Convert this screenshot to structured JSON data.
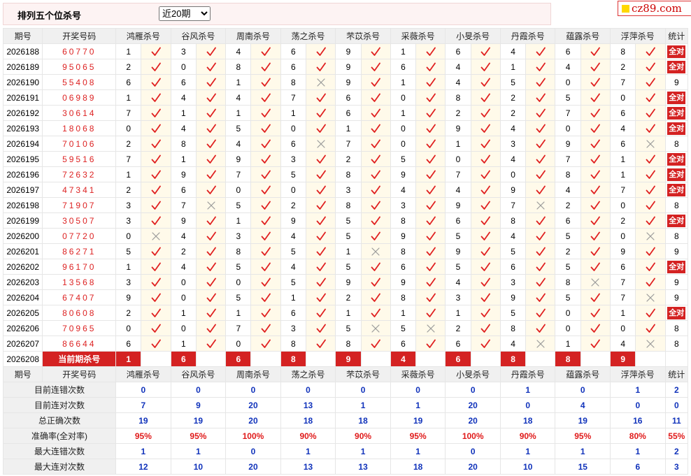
{
  "header": {
    "title": "排列五个位杀号",
    "period_select": "近20期",
    "logo": "cz89.com"
  },
  "columns": {
    "issue": "期号",
    "draw": "开奖号码",
    "stat": "统计",
    "experts": [
      "鸿雁杀号",
      "谷风杀号",
      "周南杀号",
      "荡之杀号",
      "芣苡杀号",
      "采薇杀号",
      "小旻杀号",
      "丹霞杀号",
      "蕴露杀号",
      "浮萍杀号"
    ]
  },
  "rows": [
    {
      "issue": "2026188",
      "draw": "60770",
      "k": [
        "1",
        "3",
        "4",
        "6",
        "9",
        "1",
        "6",
        "4",
        "6",
        "8"
      ],
      "r": [
        1,
        1,
        1,
        1,
        1,
        1,
        1,
        1,
        1,
        1
      ],
      "stat": "全对"
    },
    {
      "issue": "2026189",
      "draw": "95065",
      "k": [
        "2",
        "0",
        "8",
        "6",
        "9",
        "6",
        "4",
        "1",
        "4",
        "2"
      ],
      "r": [
        1,
        1,
        1,
        1,
        1,
        1,
        1,
        1,
        1,
        1
      ],
      "stat": "全对"
    },
    {
      "issue": "2026190",
      "draw": "55408",
      "k": [
        "6",
        "6",
        "1",
        "8",
        "9",
        "1",
        "4",
        "5",
        "0",
        "7"
      ],
      "r": [
        1,
        1,
        1,
        0,
        1,
        1,
        1,
        1,
        1,
        1
      ],
      "stat": "9"
    },
    {
      "issue": "2026191",
      "draw": "06989",
      "k": [
        "1",
        "4",
        "4",
        "7",
        "6",
        "0",
        "8",
        "2",
        "5",
        "0"
      ],
      "r": [
        1,
        1,
        1,
        1,
        1,
        1,
        1,
        1,
        1,
        1
      ],
      "stat": "全对"
    },
    {
      "issue": "2026192",
      "draw": "30614",
      "k": [
        "7",
        "1",
        "1",
        "1",
        "6",
        "1",
        "2",
        "2",
        "7",
        "6"
      ],
      "r": [
        1,
        1,
        1,
        1,
        1,
        1,
        1,
        1,
        1,
        1
      ],
      "stat": "全对"
    },
    {
      "issue": "2026193",
      "draw": "18068",
      "k": [
        "0",
        "4",
        "5",
        "0",
        "1",
        "0",
        "9",
        "4",
        "0",
        "4"
      ],
      "r": [
        1,
        1,
        1,
        1,
        1,
        1,
        1,
        1,
        1,
        1
      ],
      "stat": "全对"
    },
    {
      "issue": "2026194",
      "draw": "70106",
      "k": [
        "2",
        "8",
        "4",
        "6",
        "7",
        "0",
        "1",
        "3",
        "9",
        "6"
      ],
      "r": [
        1,
        1,
        1,
        0,
        1,
        1,
        1,
        1,
        1,
        0
      ],
      "stat": "8"
    },
    {
      "issue": "2026195",
      "draw": "59516",
      "k": [
        "7",
        "1",
        "9",
        "3",
        "2",
        "5",
        "0",
        "4",
        "7",
        "1"
      ],
      "r": [
        1,
        1,
        1,
        1,
        1,
        1,
        1,
        1,
        1,
        1
      ],
      "stat": "全对"
    },
    {
      "issue": "2026196",
      "draw": "72632",
      "k": [
        "1",
        "9",
        "7",
        "5",
        "8",
        "9",
        "7",
        "0",
        "8",
        "1"
      ],
      "r": [
        1,
        1,
        1,
        1,
        1,
        1,
        1,
        1,
        1,
        1
      ],
      "stat": "全对"
    },
    {
      "issue": "2026197",
      "draw": "47341",
      "k": [
        "2",
        "6",
        "0",
        "0",
        "3",
        "4",
        "4",
        "9",
        "4",
        "7"
      ],
      "r": [
        1,
        1,
        1,
        1,
        1,
        1,
        1,
        1,
        1,
        1
      ],
      "stat": "全对"
    },
    {
      "issue": "2026198",
      "draw": "71907",
      "k": [
        "3",
        "7",
        "5",
        "2",
        "8",
        "3",
        "9",
        "7",
        "2",
        "0"
      ],
      "r": [
        1,
        0,
        1,
        1,
        1,
        1,
        1,
        0,
        1,
        1
      ],
      "stat": "8"
    },
    {
      "issue": "2026199",
      "draw": "30507",
      "k": [
        "3",
        "9",
        "1",
        "9",
        "5",
        "8",
        "6",
        "8",
        "6",
        "2"
      ],
      "r": [
        1,
        1,
        1,
        1,
        1,
        1,
        1,
        1,
        1,
        1
      ],
      "stat": "全对"
    },
    {
      "issue": "2026200",
      "draw": "07720",
      "k": [
        "0",
        "4",
        "3",
        "4",
        "5",
        "9",
        "5",
        "4",
        "5",
        "0"
      ],
      "r": [
        0,
        1,
        1,
        1,
        1,
        1,
        1,
        1,
        1,
        0
      ],
      "stat": "8"
    },
    {
      "issue": "2026201",
      "draw": "86271",
      "k": [
        "5",
        "2",
        "8",
        "5",
        "1",
        "8",
        "9",
        "5",
        "2",
        "9"
      ],
      "r": [
        1,
        1,
        1,
        1,
        0,
        1,
        1,
        1,
        1,
        1
      ],
      "stat": "9"
    },
    {
      "issue": "2026202",
      "draw": "96170",
      "k": [
        "1",
        "4",
        "5",
        "4",
        "5",
        "6",
        "5",
        "6",
        "5",
        "6"
      ],
      "r": [
        1,
        1,
        1,
        1,
        1,
        1,
        1,
        1,
        1,
        1
      ],
      "stat": "全对"
    },
    {
      "issue": "2026203",
      "draw": "13568",
      "k": [
        "3",
        "0",
        "0",
        "5",
        "9",
        "9",
        "4",
        "3",
        "8",
        "7"
      ],
      "r": [
        1,
        1,
        1,
        1,
        1,
        1,
        1,
        1,
        0,
        1
      ],
      "stat": "9"
    },
    {
      "issue": "2026204",
      "draw": "67407",
      "k": [
        "9",
        "0",
        "5",
        "1",
        "2",
        "8",
        "3",
        "9",
        "5",
        "7"
      ],
      "r": [
        1,
        1,
        1,
        1,
        1,
        1,
        1,
        1,
        1,
        0
      ],
      "stat": "9"
    },
    {
      "issue": "2026205",
      "draw": "80608",
      "k": [
        "2",
        "1",
        "1",
        "6",
        "1",
        "1",
        "1",
        "5",
        "0",
        "1"
      ],
      "r": [
        1,
        1,
        1,
        1,
        1,
        1,
        1,
        1,
        1,
        1
      ],
      "stat": "全对"
    },
    {
      "issue": "2026206",
      "draw": "70965",
      "k": [
        "0",
        "0",
        "7",
        "3",
        "5",
        "5",
        "2",
        "8",
        "0",
        "0"
      ],
      "r": [
        1,
        1,
        1,
        1,
        0,
        0,
        1,
        1,
        1,
        1
      ],
      "stat": "8"
    },
    {
      "issue": "2026207",
      "draw": "86644",
      "k": [
        "6",
        "1",
        "0",
        "8",
        "8",
        "6",
        "6",
        "4",
        "1",
        "4"
      ],
      "r": [
        1,
        1,
        1,
        1,
        1,
        1,
        1,
        0,
        1,
        0
      ],
      "stat": "8"
    }
  ],
  "current": {
    "issue": "2026208",
    "label": "当前期杀号",
    "k": [
      "1",
      "6",
      "6",
      "8",
      "9",
      "4",
      "6",
      "8",
      "8",
      "9"
    ]
  },
  "summary": [
    {
      "label": "目前连错次数",
      "v": [
        "0",
        "0",
        "0",
        "0",
        "0",
        "0",
        "0",
        "1",
        "0",
        "1",
        "2"
      ],
      "red": false
    },
    {
      "label": "目前连对次数",
      "v": [
        "7",
        "9",
        "20",
        "13",
        "1",
        "1",
        "20",
        "0",
        "4",
        "0",
        "0"
      ],
      "red": false
    },
    {
      "label": "总正确次数",
      "v": [
        "19",
        "19",
        "20",
        "18",
        "18",
        "19",
        "20",
        "18",
        "19",
        "16",
        "11"
      ],
      "red": false
    },
    {
      "label": "准确率(全对率)",
      "v": [
        "95%",
        "95%",
        "100%",
        "90%",
        "90%",
        "95%",
        "100%",
        "90%",
        "95%",
        "80%",
        "55%"
      ],
      "red": true
    },
    {
      "label": "最大连错次数",
      "v": [
        "1",
        "1",
        "0",
        "1",
        "1",
        "1",
        "0",
        "1",
        "1",
        "1",
        "2"
      ],
      "red": false
    },
    {
      "label": "最大连对次数",
      "v": [
        "12",
        "10",
        "20",
        "13",
        "13",
        "18",
        "20",
        "10",
        "15",
        "6",
        "3"
      ],
      "red": false
    }
  ],
  "colors": {
    "accent_red": "#d42222",
    "check_red": "#e02020",
    "blue_value": "#1133bb",
    "marker_bg": "#fffaea"
  }
}
